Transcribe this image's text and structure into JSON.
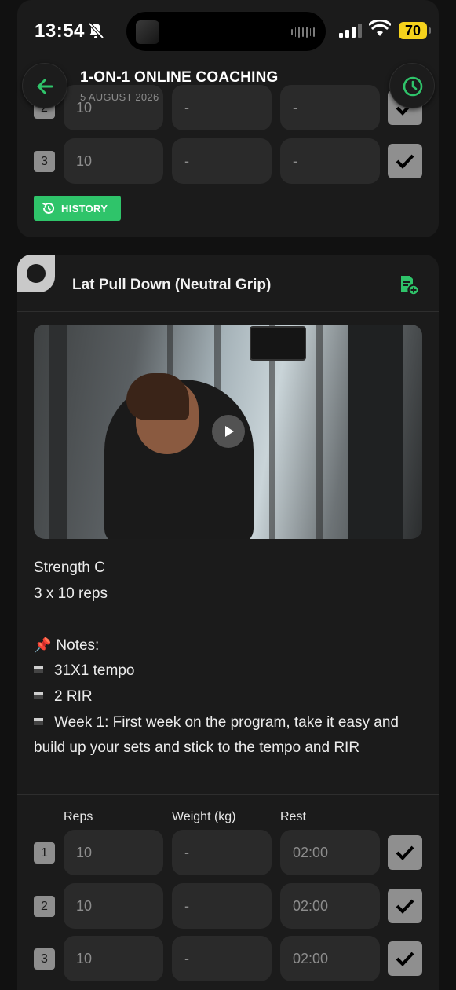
{
  "status_bar": {
    "time": "13:54",
    "battery": "70"
  },
  "header": {
    "title": "1-ON-1 ONLINE COACHING",
    "date": "5 AUGUST 2026"
  },
  "previous_exercise": {
    "sets": [
      {
        "number": "2",
        "reps": "10",
        "weight": "-",
        "rest": "-"
      },
      {
        "number": "3",
        "reps": "10",
        "weight": "-",
        "rest": "-"
      }
    ],
    "history_label": "HISTORY"
  },
  "exercise": {
    "title": "Lat Pull Down (Neutral Grip)",
    "category": "Strength C",
    "prescription": "3 x 10 reps",
    "notes_title": "Notes:",
    "notes": [
      "31X1 tempo",
      "2 RIR",
      "Week 1: First week on the program, take it easy and build up your sets and stick to the tempo and RIR"
    ],
    "columns": {
      "reps": "Reps",
      "weight": "Weight (kg)",
      "rest": "Rest"
    },
    "sets": [
      {
        "number": "1",
        "reps": "10",
        "weight": "-",
        "rest": "02:00"
      },
      {
        "number": "2",
        "reps": "10",
        "weight": "-",
        "rest": "02:00"
      },
      {
        "number": "3",
        "reps": "10",
        "weight": "-",
        "rest": "02:00"
      }
    ]
  },
  "colors": {
    "accent_green": "#2fc46a",
    "battery_yellow": "#f5d21c",
    "background": "#111111",
    "card": "#1b1b1b"
  }
}
